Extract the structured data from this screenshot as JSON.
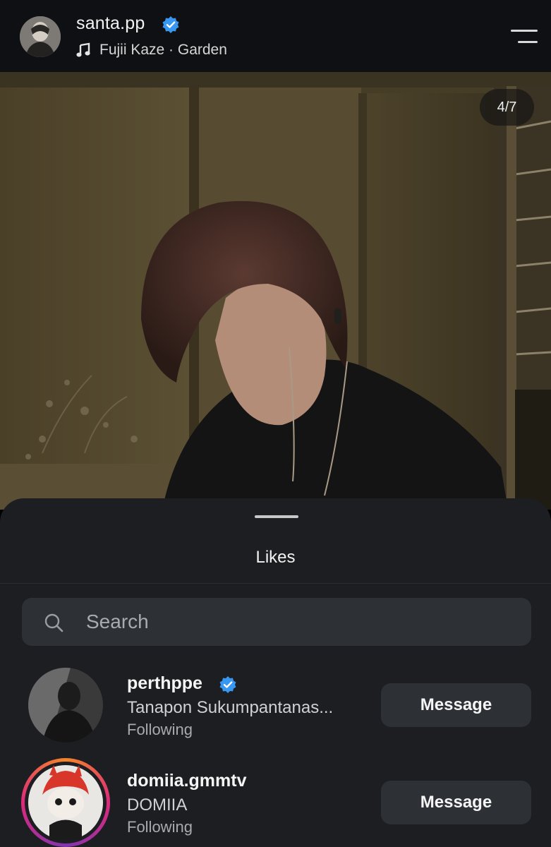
{
  "header": {
    "username": "santa.pp",
    "song": "Fujii Kaze · Garden",
    "avatar_icon": "profile-avatar",
    "verified_icon": "verified-badge-icon",
    "music_icon": "music-note-icon",
    "menu_icon": "menu-icon"
  },
  "photo": {
    "counter": "4/7"
  },
  "sheet": {
    "title": "Likes",
    "search": {
      "placeholder": "Search",
      "value": ""
    }
  },
  "likes": [
    {
      "username": "perthppe",
      "fullname": "Tanapon Sukumpantanas...",
      "status": "Following",
      "verified": true,
      "button": "Message"
    },
    {
      "username": "domiia.gmmtv",
      "fullname": "DOMIIA",
      "status": "Following",
      "verified": false,
      "button": "Message"
    }
  ],
  "colors": {
    "accent": "#3897f0",
    "sheet": "#1c1e22",
    "header": "#0e1013",
    "button": "#2d3035"
  }
}
